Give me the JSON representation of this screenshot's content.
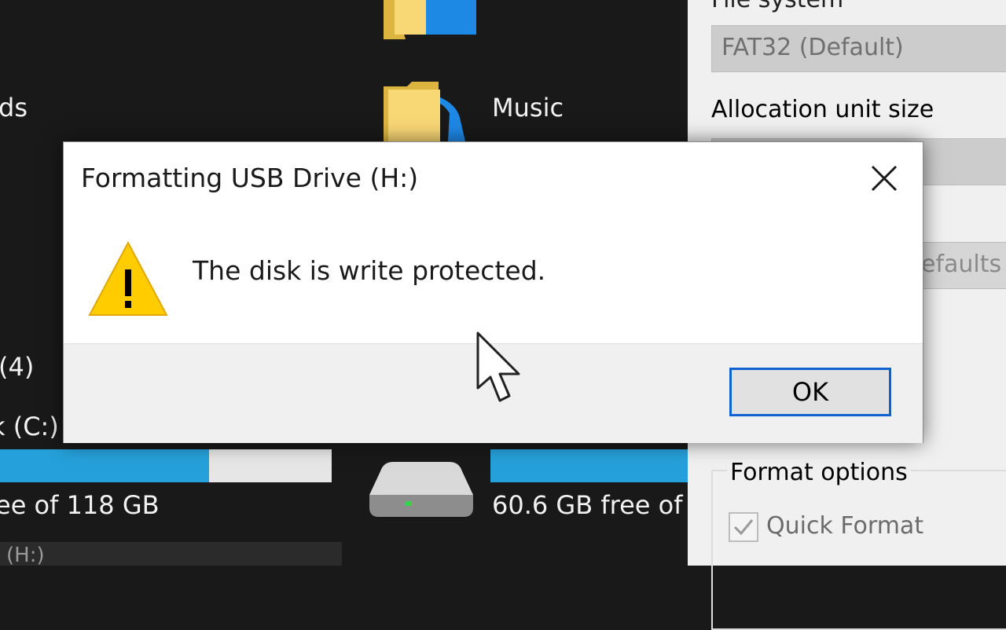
{
  "explorer": {
    "items": [
      {
        "label": "Music"
      }
    ],
    "fragments": {
      "downloads_partial": "ds",
      "devices_count_partial": "(4)",
      "local_disk_partial": "k (C:)",
      "c_free_partial": "ee of 118 GB",
      "usb_free_partial": "60.6 GB free of",
      "bottom_partial": "(H:)"
    },
    "drives": [
      {
        "name": "c-drive",
        "used_fraction": 0.63
      },
      {
        "name": "d-drive",
        "used_fraction": 1.0
      }
    ]
  },
  "format_panel": {
    "file_system_label": "File system",
    "file_system_value": "FAT32 (Default)",
    "allocation_label": "Allocation unit size",
    "restore_defaults_partial": "efaults",
    "format_options_label": "Format options",
    "quick_format_label": "Quick Format",
    "quick_format_checked": true
  },
  "dialog": {
    "title": "Formatting USB Drive (H:)",
    "message": "The disk is write protected.",
    "ok_label": "OK",
    "icon": "warning-icon"
  },
  "colors": {
    "accent_blue": "#26a0da",
    "button_focus_border": "#0f62cf",
    "warning_yellow": "#ffcc00"
  }
}
